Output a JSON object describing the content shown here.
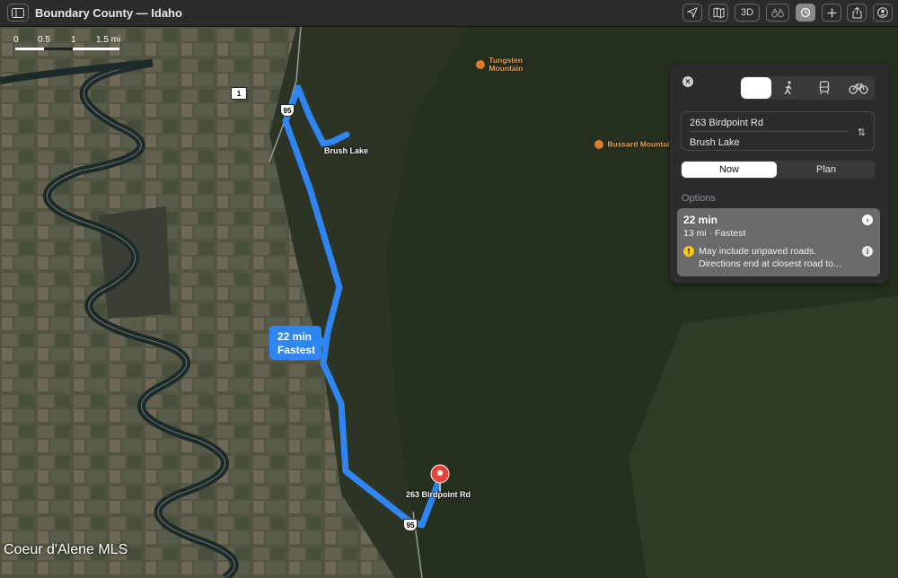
{
  "window": {
    "title": "Boundary County — Idaho",
    "toolbar": {
      "sidebar_icon": "sidebar-icon",
      "buttons": [
        "location-arrow-icon",
        "map-icon",
        "3D",
        "binoculars-icon",
        "tracking-icon",
        "plus-icon",
        "share-icon",
        "account-icon"
      ]
    }
  },
  "map": {
    "scale": {
      "labels": [
        "0",
        "0.5",
        "1",
        "1.5 mi"
      ]
    },
    "places": {
      "brush_lake": "Brush Lake",
      "tungsten": "Tungsten\nMountain",
      "bussard": "Bussard Mountai",
      "destination": "263 Birdpoint Rd"
    },
    "shields": {
      "hwy1": "1",
      "us95_top": "95",
      "us95_bottom": "95"
    },
    "route_callout": {
      "time": "22 min",
      "label": "Fastest"
    },
    "route_color": "#2f86f2",
    "watermark": "Coeur d'Alene MLS"
  },
  "directions": {
    "modes": [
      "car-icon",
      "walk-icon",
      "transit-icon",
      "bike-icon"
    ],
    "selected_mode": "car-icon",
    "from": "263 Birdpoint Rd",
    "to": "Brush Lake",
    "timing": {
      "now": "Now",
      "plan": "Plan"
    },
    "options_label": "Options",
    "option": {
      "time": "22 min",
      "summary": "13 mi · Fastest",
      "warning_line1": "May include unpaved roads.",
      "warning_line2": "Directions end at closest road to..."
    }
  }
}
